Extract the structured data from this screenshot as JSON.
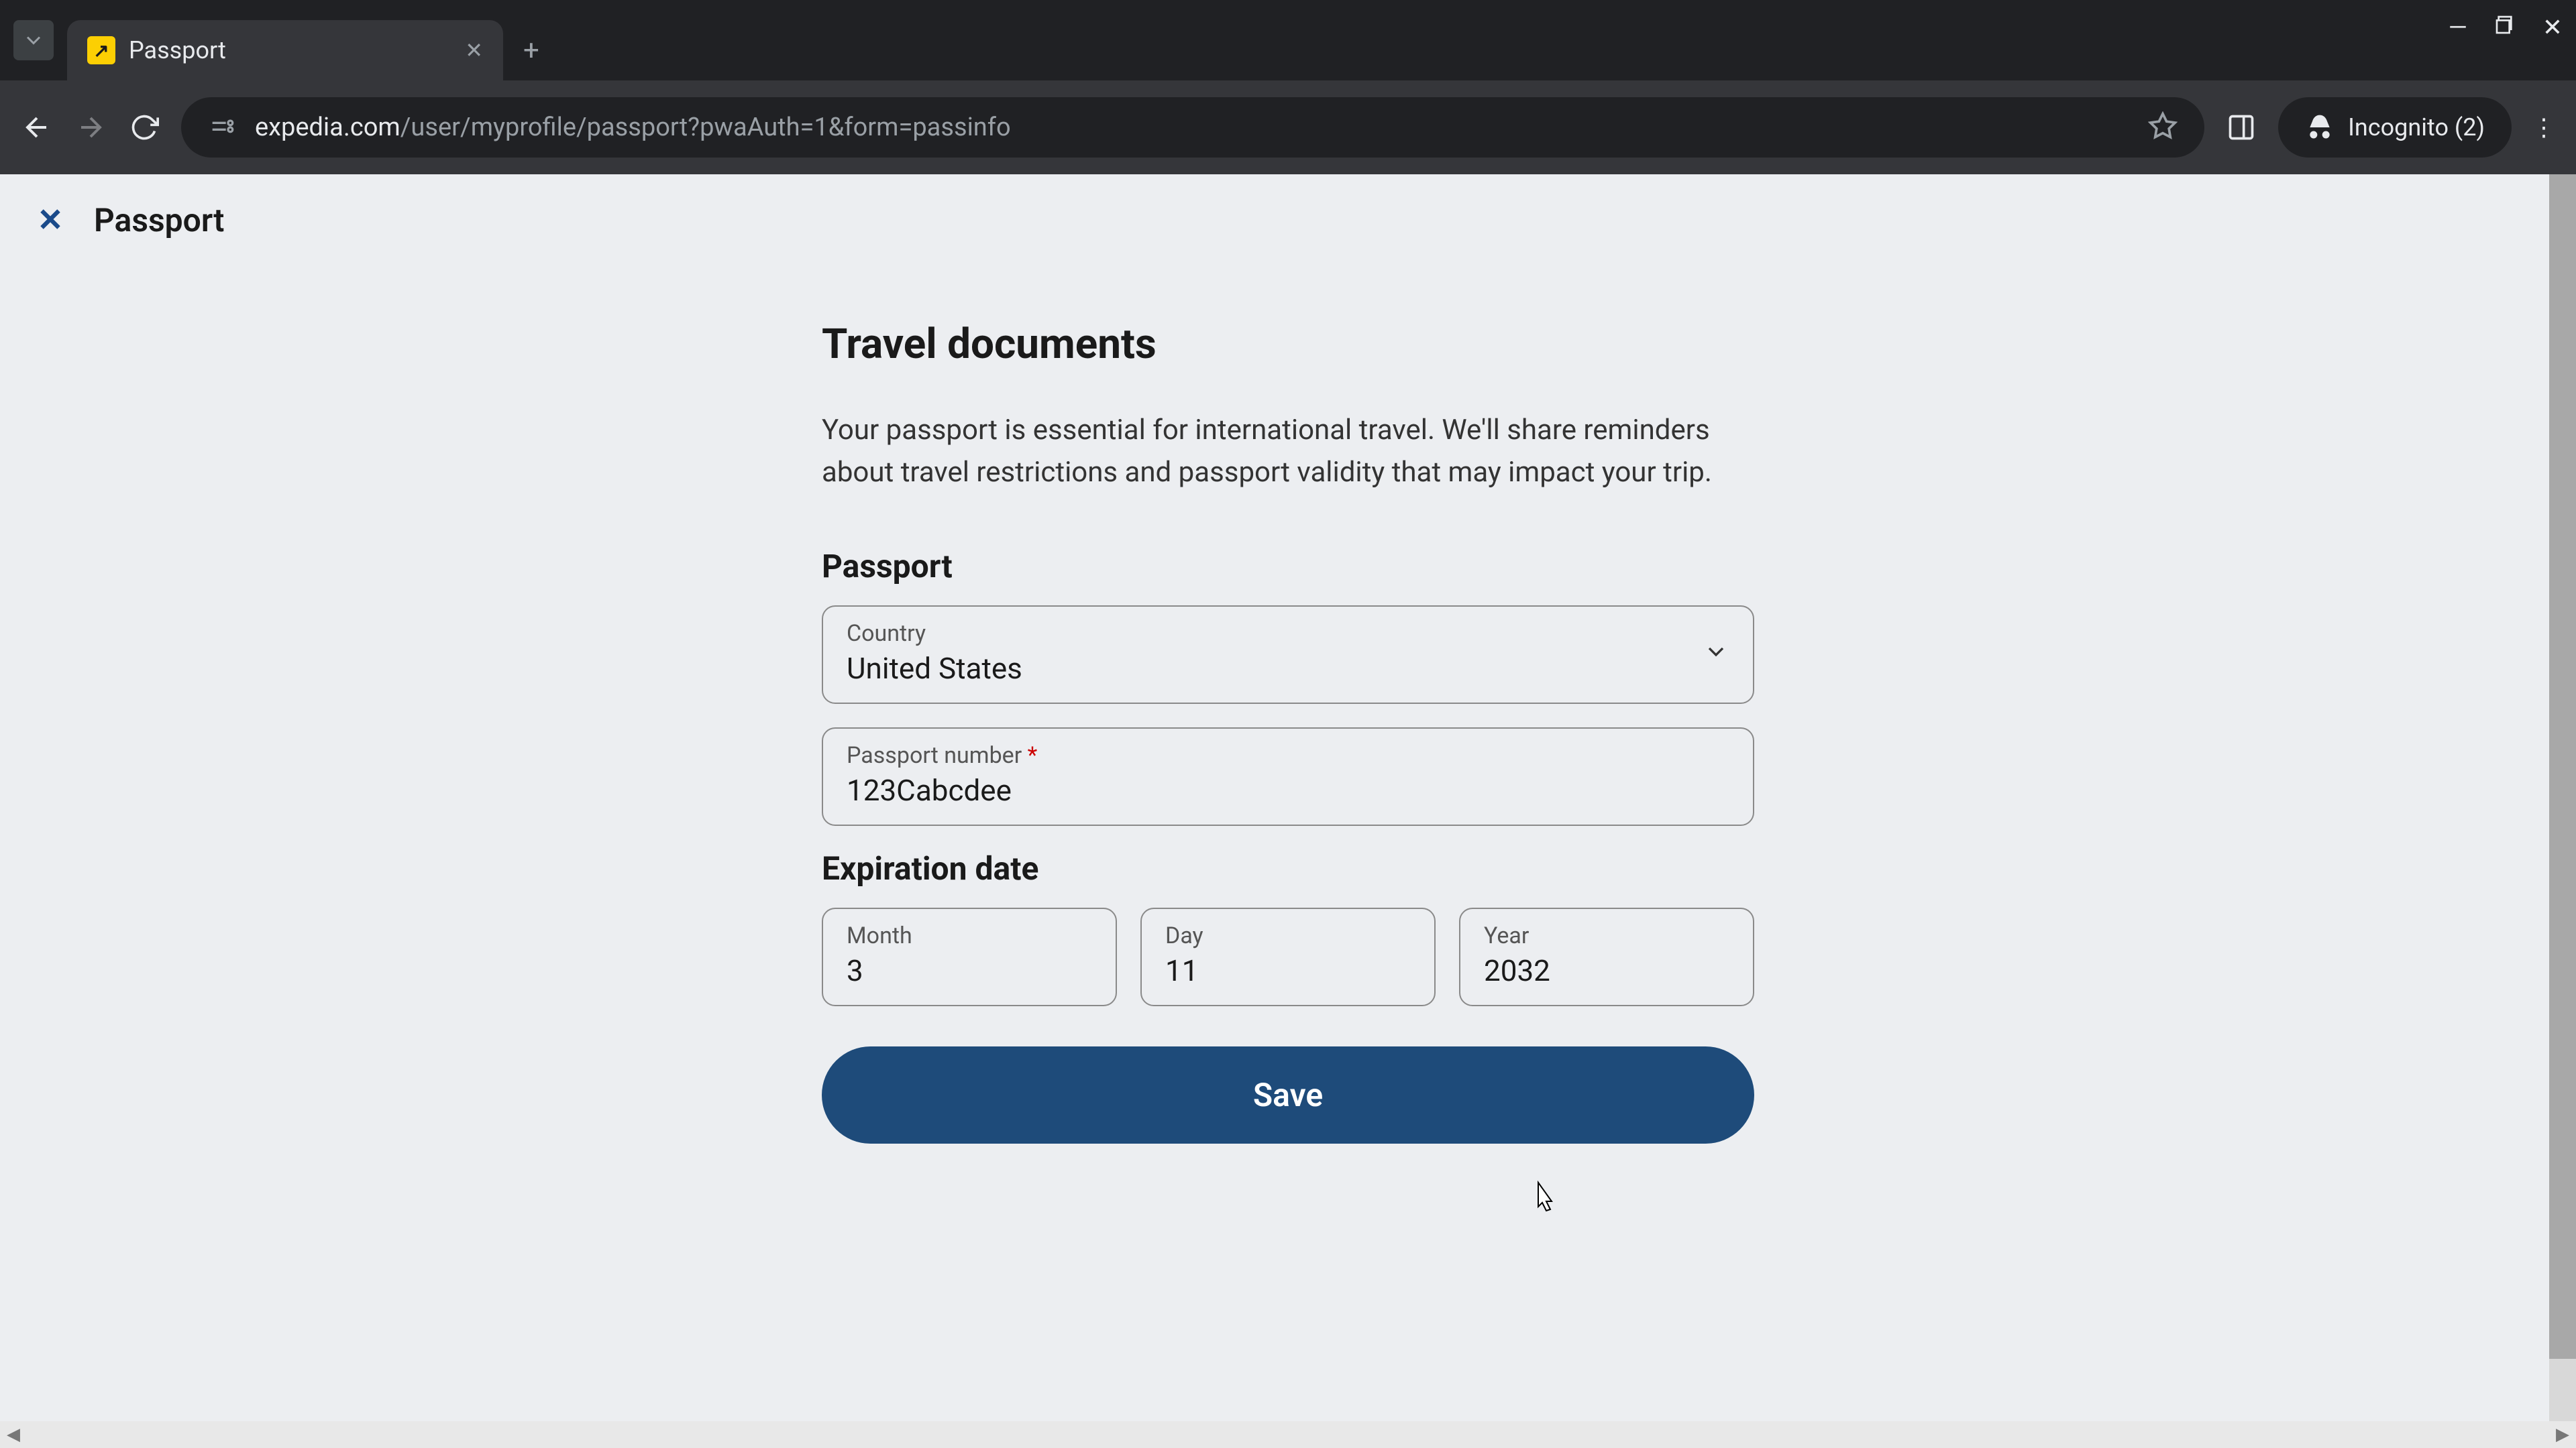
{
  "browser": {
    "tab": {
      "title": "Passport"
    },
    "url_domain": "expedia.com",
    "url_path": "/user/myprofile/passport?pwaAuth=1&form=passinfo",
    "incognito_label": "Incognito (2)"
  },
  "page": {
    "header_title": "Passport",
    "heading": "Travel documents",
    "description": "Your passport is essential for international travel. We'll share reminders about travel restrictions and passport validity that may impact your trip.",
    "passport_section": "Passport",
    "country_label": "Country",
    "country_value": "United States",
    "passport_number_label": "Passport number ",
    "passport_number_required": "*",
    "passport_number_value": "123Cabcdee",
    "expiration_section": "Expiration date",
    "month_label": "Month",
    "month_value": "3",
    "day_label": "Day",
    "day_value": "11",
    "year_label": "Year",
    "year_value": "2032",
    "save_label": "Save"
  }
}
